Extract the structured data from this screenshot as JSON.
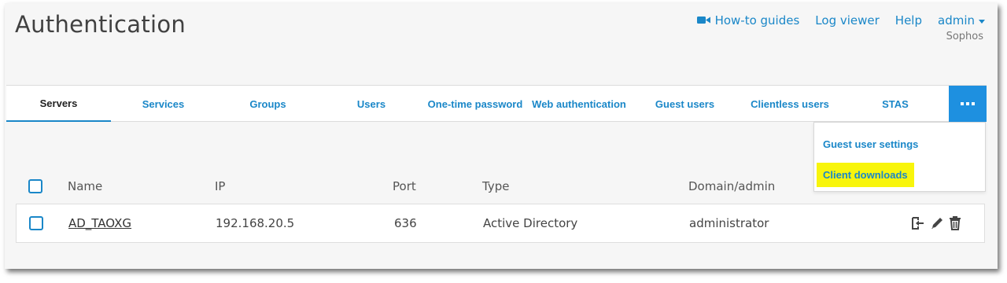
{
  "header": {
    "title": "Authentication",
    "links": {
      "howto": "How-to guides",
      "log_viewer": "Log viewer",
      "help": "Help",
      "user": "admin"
    },
    "org": "Sophos"
  },
  "tabs": [
    {
      "label": "Servers",
      "active": true
    },
    {
      "label": "Services"
    },
    {
      "label": "Groups"
    },
    {
      "label": "Users"
    },
    {
      "label": "One-time password"
    },
    {
      "label": "Web authentication"
    },
    {
      "label": "Guest users"
    },
    {
      "label": "Clientless users"
    },
    {
      "label": "STAS"
    }
  ],
  "more_menu": {
    "items": [
      {
        "label": "Guest user settings",
        "highlighted": false
      },
      {
        "label": "Client downloads",
        "highlighted": true
      }
    ]
  },
  "table": {
    "columns": [
      "Name",
      "IP",
      "Port",
      "Type",
      "Domain/admin"
    ],
    "rows": [
      {
        "name": "AD_TAOXG",
        "ip": "192.168.20.5",
        "port": "636",
        "type": "Active Directory",
        "domain_admin": "administrator"
      }
    ],
    "row_actions": [
      "test-connection-icon",
      "edit-icon",
      "delete-icon"
    ]
  },
  "colors": {
    "accent": "#1a87c8",
    "more_button": "#1e90e0",
    "highlight": "#f8f50c"
  }
}
